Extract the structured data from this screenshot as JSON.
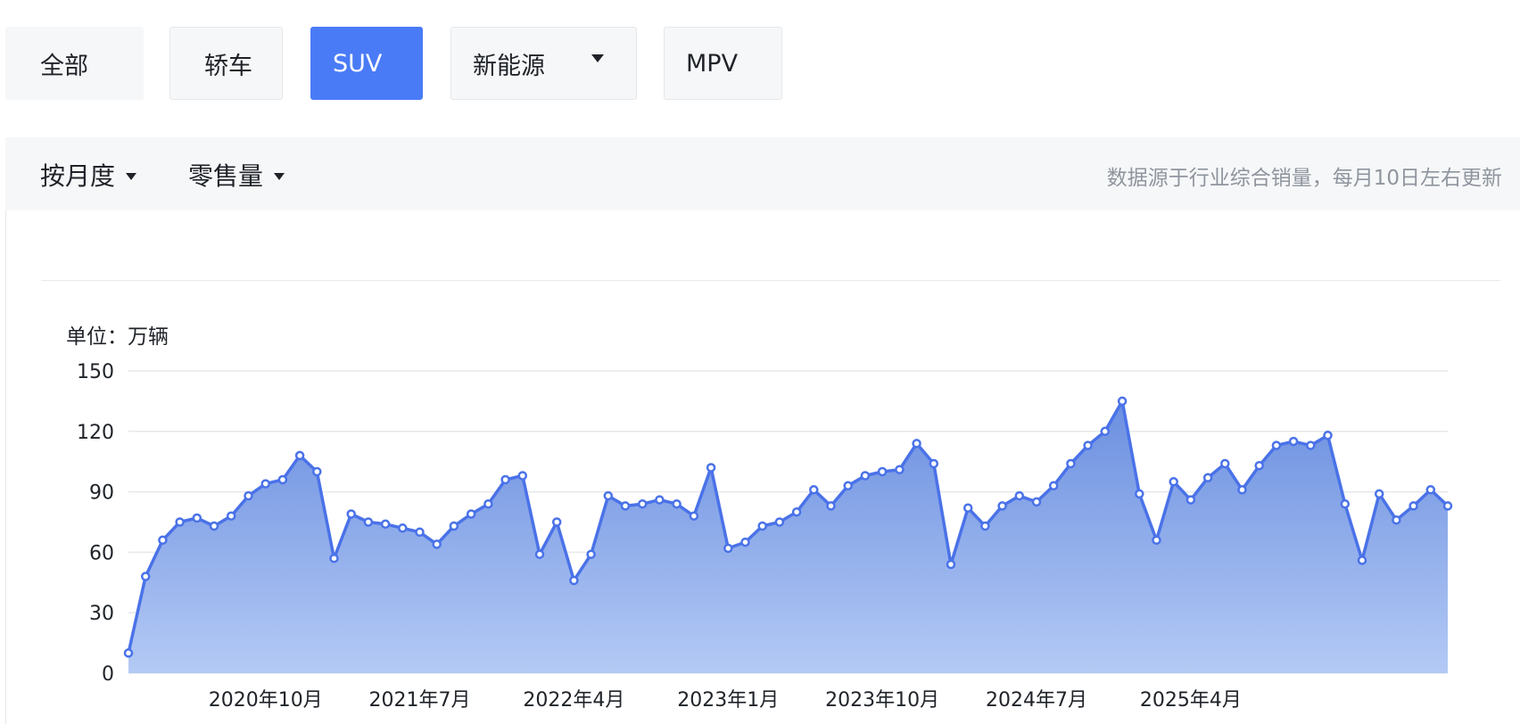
{
  "tabs": [
    {
      "label": "全部",
      "active": false
    },
    {
      "label": "轿车",
      "active": false
    },
    {
      "label": "SUV",
      "active": true
    },
    {
      "label": "新能源",
      "active": false,
      "has_dropdown": true
    },
    {
      "label": "MPV",
      "active": false
    }
  ],
  "toolbar": {
    "period_label": "按月度",
    "metric_label": "零售量",
    "source_note": "数据源于行业综合销量，每月10日左右更新"
  },
  "colors": {
    "accent": "#4a7bf7",
    "line": "#4a72e8",
    "area_top": "#6b8fe0",
    "area_bottom": "#b4caf5",
    "grid": "#e6e8eb"
  },
  "chart_data": {
    "type": "area",
    "unit_label": "单位：万辆",
    "ylim": [
      0,
      150
    ],
    "yticks": [
      0,
      30,
      60,
      90,
      120,
      150
    ],
    "grid": true,
    "x_tick_labels": [
      {
        "label": "2020年10月",
        "index": 8
      },
      {
        "label": "2021年7月",
        "index": 17
      },
      {
        "label": "2022年4月",
        "index": 26
      },
      {
        "label": "2023年1月",
        "index": 35
      },
      {
        "label": "2023年10月",
        "index": 44
      },
      {
        "label": "2024年7月",
        "index": 53
      },
      {
        "label": "2025年4月",
        "index": 62
      }
    ],
    "series": [
      {
        "values": [
          10,
          48,
          66,
          75,
          77,
          73,
          78,
          88,
          94,
          96,
          108,
          100,
          57,
          79,
          75,
          74,
          72,
          70,
          64,
          73,
          79,
          84,
          96,
          98,
          59,
          75,
          46,
          59,
          88,
          83,
          84,
          86,
          84,
          78,
          102,
          62,
          65,
          73,
          75,
          80,
          91,
          83,
          93,
          98,
          100,
          101,
          114,
          104,
          54,
          82,
          73,
          83,
          88,
          85,
          93,
          104,
          113,
          120,
          135,
          89,
          66,
          95,
          86,
          97,
          104,
          91,
          103,
          113,
          115,
          113,
          118,
          84,
          56,
          89,
          76,
          83,
          91,
          83
        ]
      }
    ]
  }
}
